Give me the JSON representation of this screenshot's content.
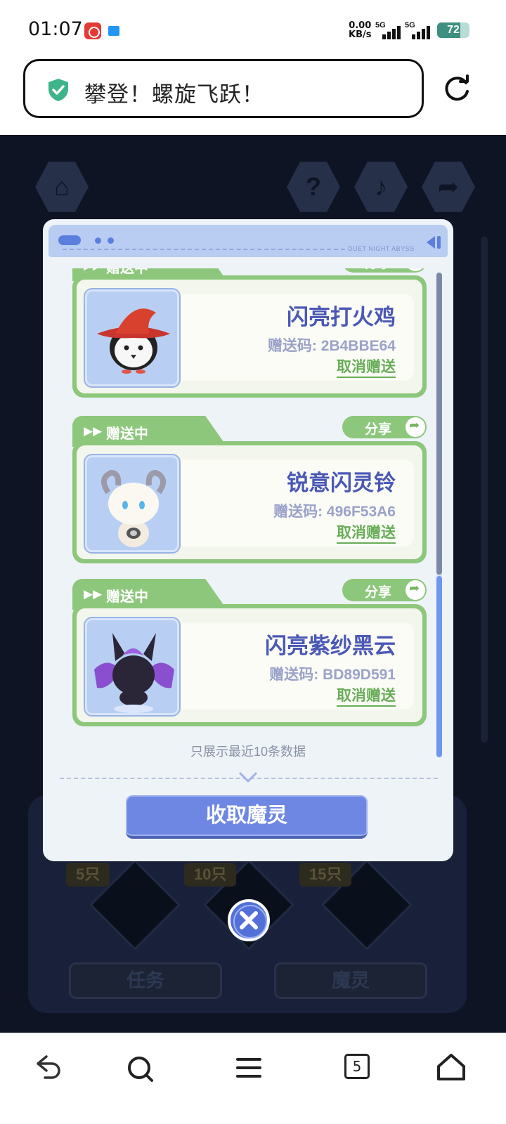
{
  "status_bar": {
    "time": "01:07",
    "net_speed_value": "0.00",
    "net_speed_unit": "KB/s",
    "signal1": "5G",
    "signal2": "5G",
    "battery_level": "72"
  },
  "browser": {
    "page_title": "攀登！螺旋飞跃！"
  },
  "dialog": {
    "header_brand": "DUET NIGHT ABYSS",
    "items": [
      {
        "status": "赠送中",
        "share_label": "分享",
        "name": "闪亮打火鸡",
        "code_label": "赠送码: 2B4BBE64",
        "cancel_label": "取消赠送"
      },
      {
        "status": "赠送中",
        "share_label": "分享",
        "name": "锐意闪灵铃",
        "code_label": "赠送码: 496F53A6",
        "cancel_label": "取消赠送"
      },
      {
        "status": "赠送中",
        "share_label": "分享",
        "name": "闪亮紫纱黑云",
        "code_label": "赠送码: BD89D591",
        "cancel_label": "取消赠送"
      }
    ],
    "note": "只展示最近10条数据",
    "collect_button": "收取魔灵"
  },
  "background": {
    "count_tags": [
      "5只",
      "10只",
      "15只"
    ],
    "task_button": "任务",
    "spirit_button": "魔灵"
  },
  "bottom_nav": {
    "tab_count": "5"
  },
  "colors": {
    "accent_blue": "#6e87e3",
    "accent_green": "#8dc77b",
    "name_color": "#4a58b5"
  }
}
